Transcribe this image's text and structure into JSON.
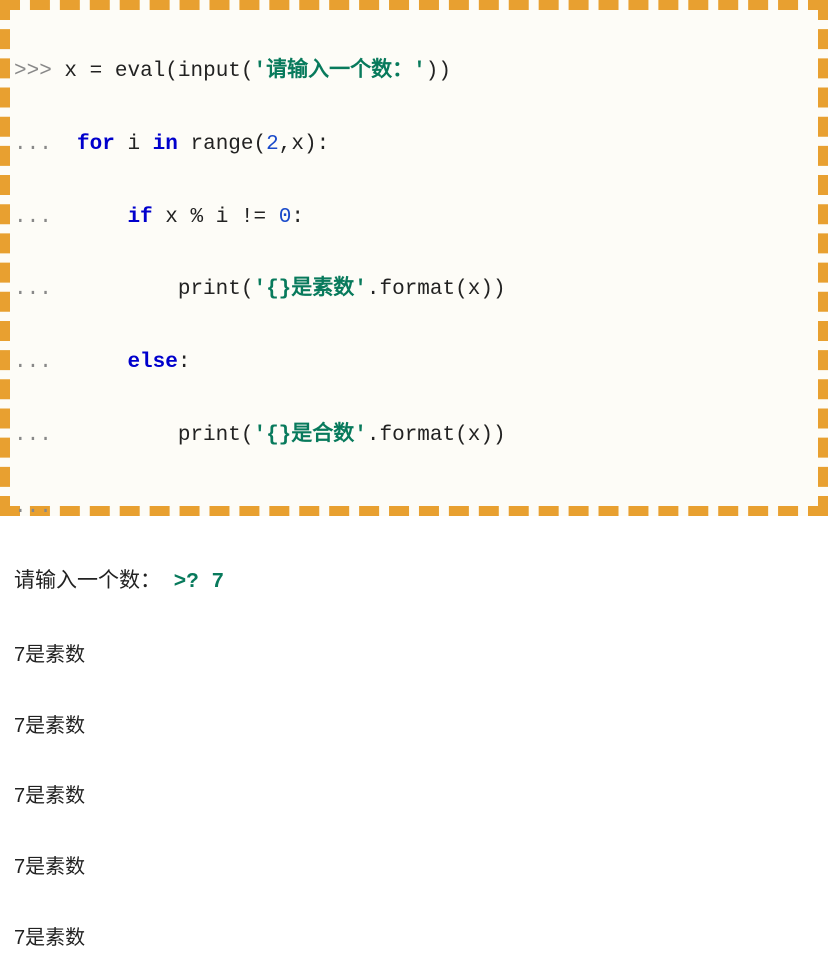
{
  "code": {
    "prompt_primary": ">>>",
    "prompt_cont": "...",
    "line1": {
      "var": "x",
      "assign": "=",
      "eval": "eval",
      "input": "input",
      "str": "'请输入一个数：'"
    },
    "line2": {
      "for": "for",
      "i": "i",
      "in": "in",
      "range": "range",
      "num": "2",
      "x": "x"
    },
    "line3": {
      "if": "if",
      "x": "x",
      "mod": "%",
      "i": "i",
      "neq": "!=",
      "zero": "0"
    },
    "line4": {
      "print": "print",
      "str": "'{}是素数'",
      "format": "format",
      "x": "x"
    },
    "line5": {
      "else": "else"
    },
    "line6": {
      "print": "print",
      "str": "'{}是合数'",
      "format": "format",
      "x": "x"
    }
  },
  "io": {
    "input_prompt": "请输入一个数：",
    "input_marker": ">?",
    "input_value": "7",
    "outputs": [
      "7是素数",
      "7是素数",
      "7是素数",
      "7是素数",
      "7是素数"
    ]
  }
}
